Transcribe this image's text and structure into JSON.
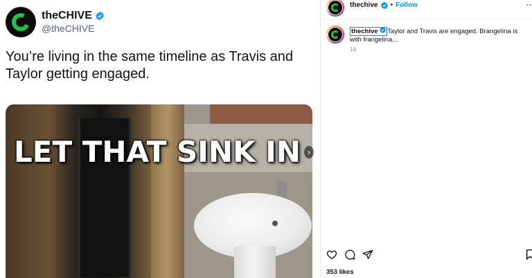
{
  "tweet": {
    "display_name": "theCHIVE",
    "handle": "@theCHIVE",
    "text": "You’re living in the same timeline as Travis and Taylor getting engaged.",
    "media_text": "LET THAT SINK IN",
    "next_arrow": "›"
  },
  "instagram": {
    "username": "thechive",
    "separator": "•",
    "follow_label": "Follow",
    "more_label": "⋯",
    "caption_user": "thechive",
    "caption_text": "Taylor and Travis are engaged. Brangelina is with frangelina...",
    "time_ago": "1d",
    "likes": "353 likes"
  },
  "colors": {
    "brand_green": "#22c24a",
    "verified_blue": "#1d9bf0",
    "link_blue": "#0095f6"
  },
  "icons": [
    "verified-badge-icon",
    "heart-icon",
    "comment-icon",
    "share-icon",
    "bookmark-icon",
    "chevron-right-icon"
  ]
}
